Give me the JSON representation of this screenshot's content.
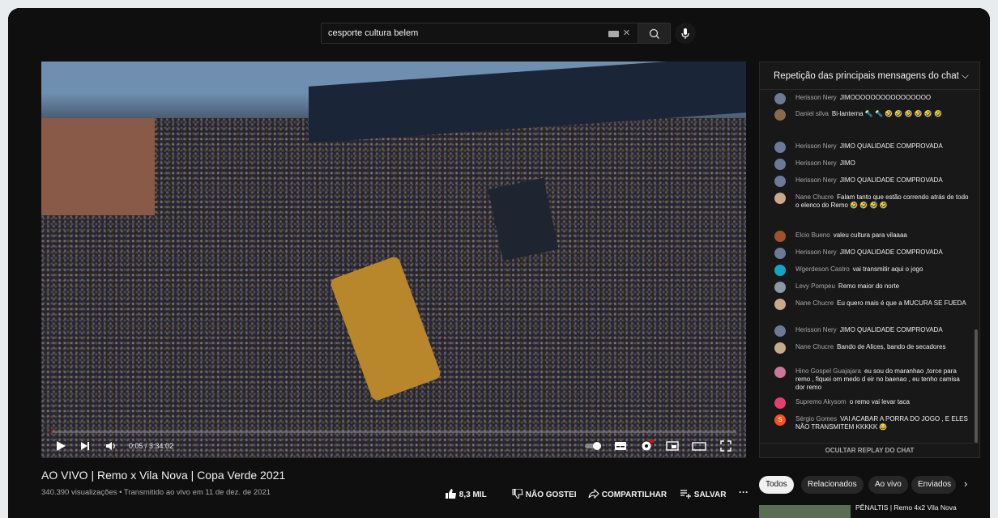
{
  "search": {
    "query": "cesporte cultura belem"
  },
  "player": {
    "time": "0:05 / 3:34:02",
    "progress_fraction": 0.002
  },
  "video": {
    "title": "AO VIVO | Remo x Vila Nova | Copa Verde 2021",
    "meta": "340.390 visualizações • Transmitido ao vivo em 11 de dez. de 2021",
    "like_count": "8,3 MIL",
    "dislike_label": "NÃO GOSTEI",
    "share_label": "COMPARTILHAR",
    "save_label": "SALVAR"
  },
  "chat": {
    "header": "Repetição das principais mensagens do chat",
    "messages": [
      {
        "author": "Herisson Nery",
        "text": "JIMOOOOOOOOOOOOOOOO",
        "color": "#6b7a99"
      },
      {
        "author": "Daniel silva",
        "text": "Bi-lanterna 🔦 🔦 🤣 🤣 🤣 🤣 🤣 🤣",
        "color": "#8a6a4a"
      },
      {
        "author": "Herisson Nery",
        "text": "JIMO QUALIDADE COMPROVADA",
        "color": "#6b7a99"
      },
      {
        "author": "Herisson Nery",
        "text": "JIMO",
        "color": "#6b7a99"
      },
      {
        "author": "Herisson Nery",
        "text": "JIMO QUALIDADE COMPROVADA",
        "color": "#6b7a99"
      },
      {
        "author": "Nane Chucre",
        "text": "Falam tanto que estão correndo atrás de todo o elenco do Remo 🤣 🤣 🤣 🤣",
        "color": "#c9a98a"
      },
      {
        "author": "Elcio Bueno",
        "text": "valeu cultura para vilaaaa",
        "color": "#a0522d"
      },
      {
        "author": "Herisson Nery",
        "text": "JIMO QUALIDADE COMPROVADA",
        "color": "#6b7a99"
      },
      {
        "author": "Wgerdeson Castro",
        "text": "vai transmitir aqui o jogo",
        "color": "#12a4c4"
      },
      {
        "author": "Levy Pompeu",
        "text": "Remo maior do norte",
        "color": "#8899aa"
      },
      {
        "author": "Nane Chucre",
        "text": "Eu quero mais é que a MUCURA SE FUEDA",
        "color": "#c9a98a"
      },
      {
        "author": "Herisson Nery",
        "text": "JIMO QUALIDADE COMPROVADA",
        "color": "#6b7a99"
      },
      {
        "author": "Nane Chucre",
        "text": "Bando de Alices, bando de secadores",
        "color": "#c9a98a"
      },
      {
        "author": "Hino Gospel Guajajara",
        "text": "eu sou do maranhao ,torce para remo , fiquei om medo d eir no baenao , eu tenho camisa dor remo",
        "color": "#cc7799"
      },
      {
        "author": "Supremo Akysom",
        "text": "o remo vai levar taca",
        "color": "#e0406a"
      },
      {
        "author": "Sérgio Gomes",
        "text": "VAI ACABAR A PORRA DO JOGO , E ELES NÃO TRANSMITEM KKKKK 😂",
        "color": "#f4511e",
        "initial": "S"
      }
    ],
    "footer": "OCULTAR REPLAY DO CHAT"
  },
  "chips": [
    "Todos",
    "Relacionados",
    "Ao vivo",
    "Enviados"
  ],
  "next_video": {
    "title": "PÊNALTIS | Remo 4x2 Vila Nova"
  },
  "icons": {
    "play": "play-icon",
    "next": "next-icon",
    "volume": "volume-icon",
    "autoplay": "autoplay-toggle-icon",
    "subtitles": "subtitles-icon",
    "settings": "gear-icon",
    "miniplayer": "miniplayer-icon",
    "theater": "theater-icon",
    "fullscreen": "fullscreen-icon"
  },
  "colors": {
    "accent": "#ff0000",
    "background": "#0f0f0f"
  }
}
